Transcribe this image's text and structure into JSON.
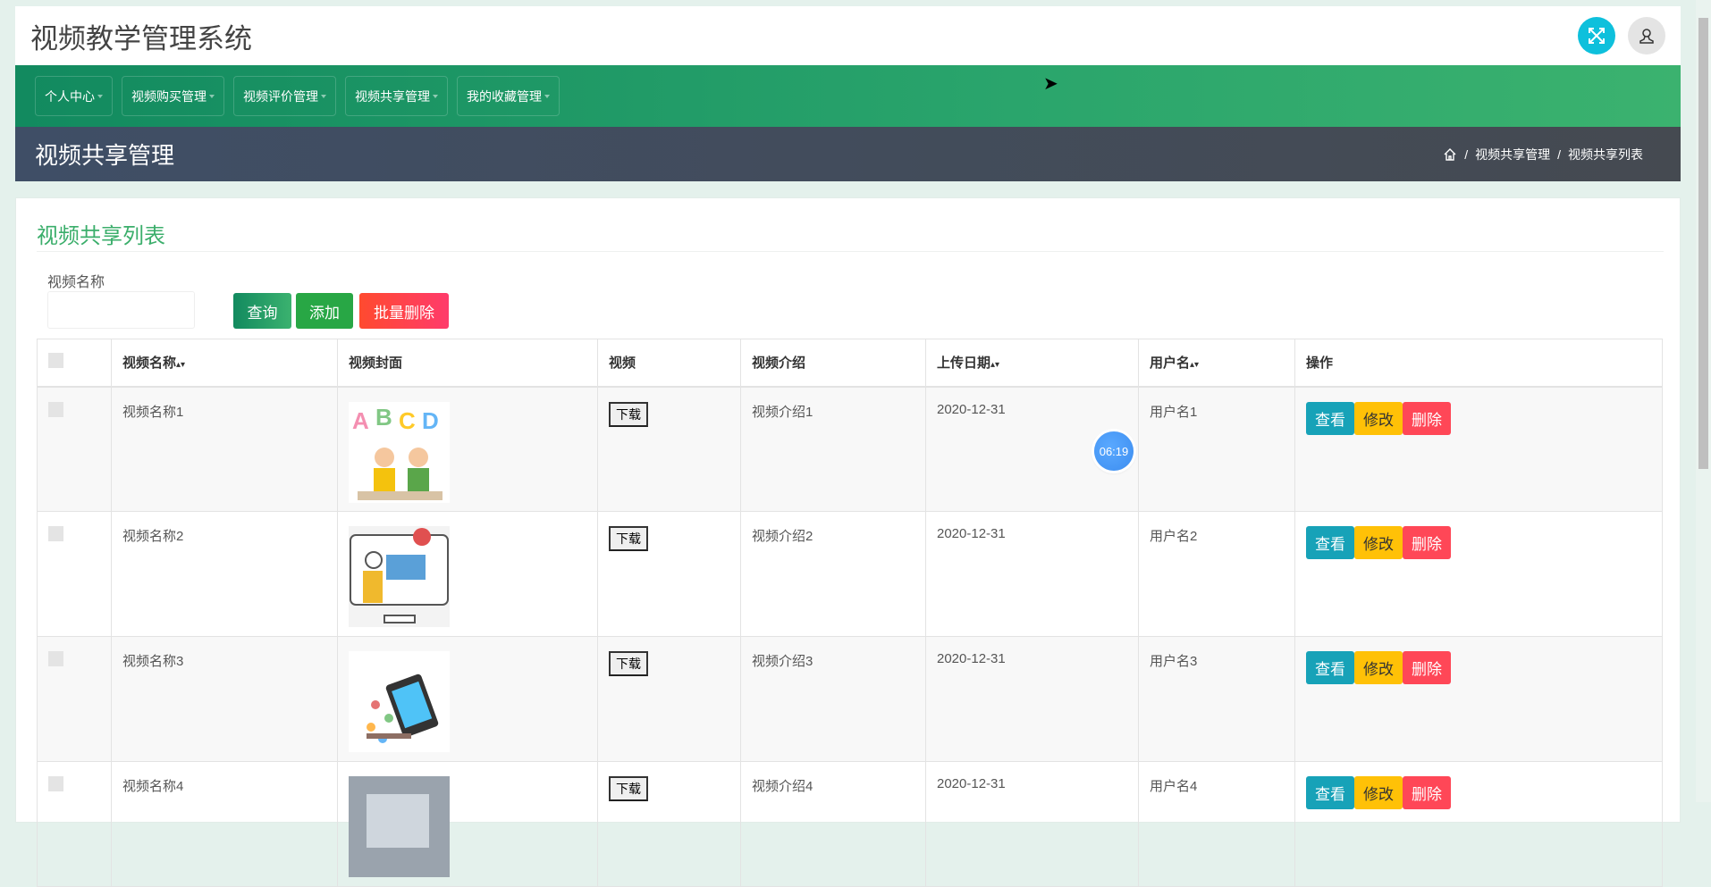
{
  "app_title": "视频教学管理系统",
  "nav": [
    "个人中心",
    "视频购买管理",
    "视频评价管理",
    "视频共享管理",
    "我的收藏管理"
  ],
  "banner": {
    "title": "视频共享管理",
    "breadcrumb": [
      "视频共享管理",
      "视频共享列表"
    ]
  },
  "card": {
    "title": "视频共享列表",
    "search_label": "视频名称",
    "search_value": "",
    "buttons": {
      "query": "查询",
      "add": "添加",
      "batch_delete": "批量删除"
    }
  },
  "table": {
    "headers": [
      "视频名称",
      "视频封面",
      "视频",
      "视频介绍",
      "上传日期",
      "用户名",
      "操作"
    ],
    "rows": [
      {
        "name": "视频名称1",
        "download": "下载",
        "intro": "视频介绍1",
        "date": "2020-12-31",
        "user": "用户名1"
      },
      {
        "name": "视频名称2",
        "download": "下载",
        "intro": "视频介绍2",
        "date": "2020-12-31",
        "user": "用户名2"
      },
      {
        "name": "视频名称3",
        "download": "下载",
        "intro": "视频介绍3",
        "date": "2020-12-31",
        "user": "用户名3"
      },
      {
        "name": "视频名称4",
        "download": "下载",
        "intro": "视频介绍4",
        "date": "2020-12-31",
        "user": "用户名4"
      }
    ],
    "actions": {
      "view": "查看",
      "edit": "修改",
      "delete": "删除"
    }
  },
  "timer_bubble": "06:19",
  "colors": {
    "primary": "#1f9a66",
    "view": "#17a2b8",
    "edit": "#ffc107",
    "delete": "#ff4757"
  }
}
